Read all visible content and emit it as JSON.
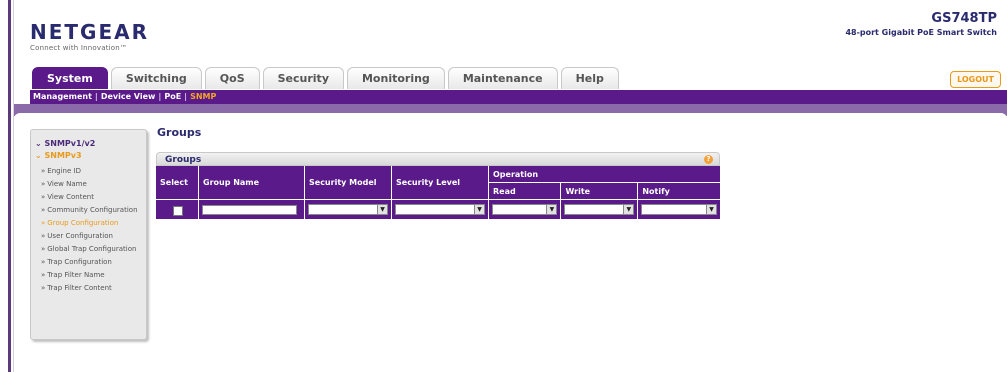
{
  "header": {
    "brand": "NETGEAR",
    "tagline": "Connect with Innovation™",
    "model": "GS748TP",
    "model_desc": "48-port Gigabit PoE Smart Switch",
    "logout_label": "LOGOUT"
  },
  "tabs": [
    {
      "label": "System",
      "active": true
    },
    {
      "label": "Switching"
    },
    {
      "label": "QoS"
    },
    {
      "label": "Security"
    },
    {
      "label": "Monitoring"
    },
    {
      "label": "Maintenance"
    },
    {
      "label": "Help"
    }
  ],
  "subnav": {
    "items": [
      "Management",
      "Device View",
      "PoE",
      "SNMP"
    ],
    "current": "SNMP"
  },
  "sidebar": {
    "sections": [
      {
        "label": "SNMPv1/v2"
      },
      {
        "label": "SNMPv3"
      }
    ],
    "items": [
      "Engine ID",
      "View Name",
      "View Content",
      "Community Configuration",
      "Group Configuration",
      "User Configuration",
      "Global Trap Configuration",
      "Trap Configuration",
      "Trap Filter Name",
      "Trap Filter Content"
    ],
    "active_item": "Group Configuration"
  },
  "main": {
    "title": "Groups",
    "panel_title": "Groups",
    "help_glyph": "?",
    "columns": {
      "select": "Select",
      "group_name": "Group Name",
      "security_model": "Security Model",
      "security_level": "Security Level",
      "operation": "Operation",
      "read": "Read",
      "write": "Write",
      "notify": "Notify"
    },
    "row": {
      "group_name": "",
      "security_model": "",
      "security_level": "",
      "read": "",
      "write": "",
      "notify": ""
    }
  },
  "colors": {
    "brand_purple": "#5a1a8a",
    "accent_orange": "#e79a1b",
    "navy": "#2a2a6e"
  }
}
